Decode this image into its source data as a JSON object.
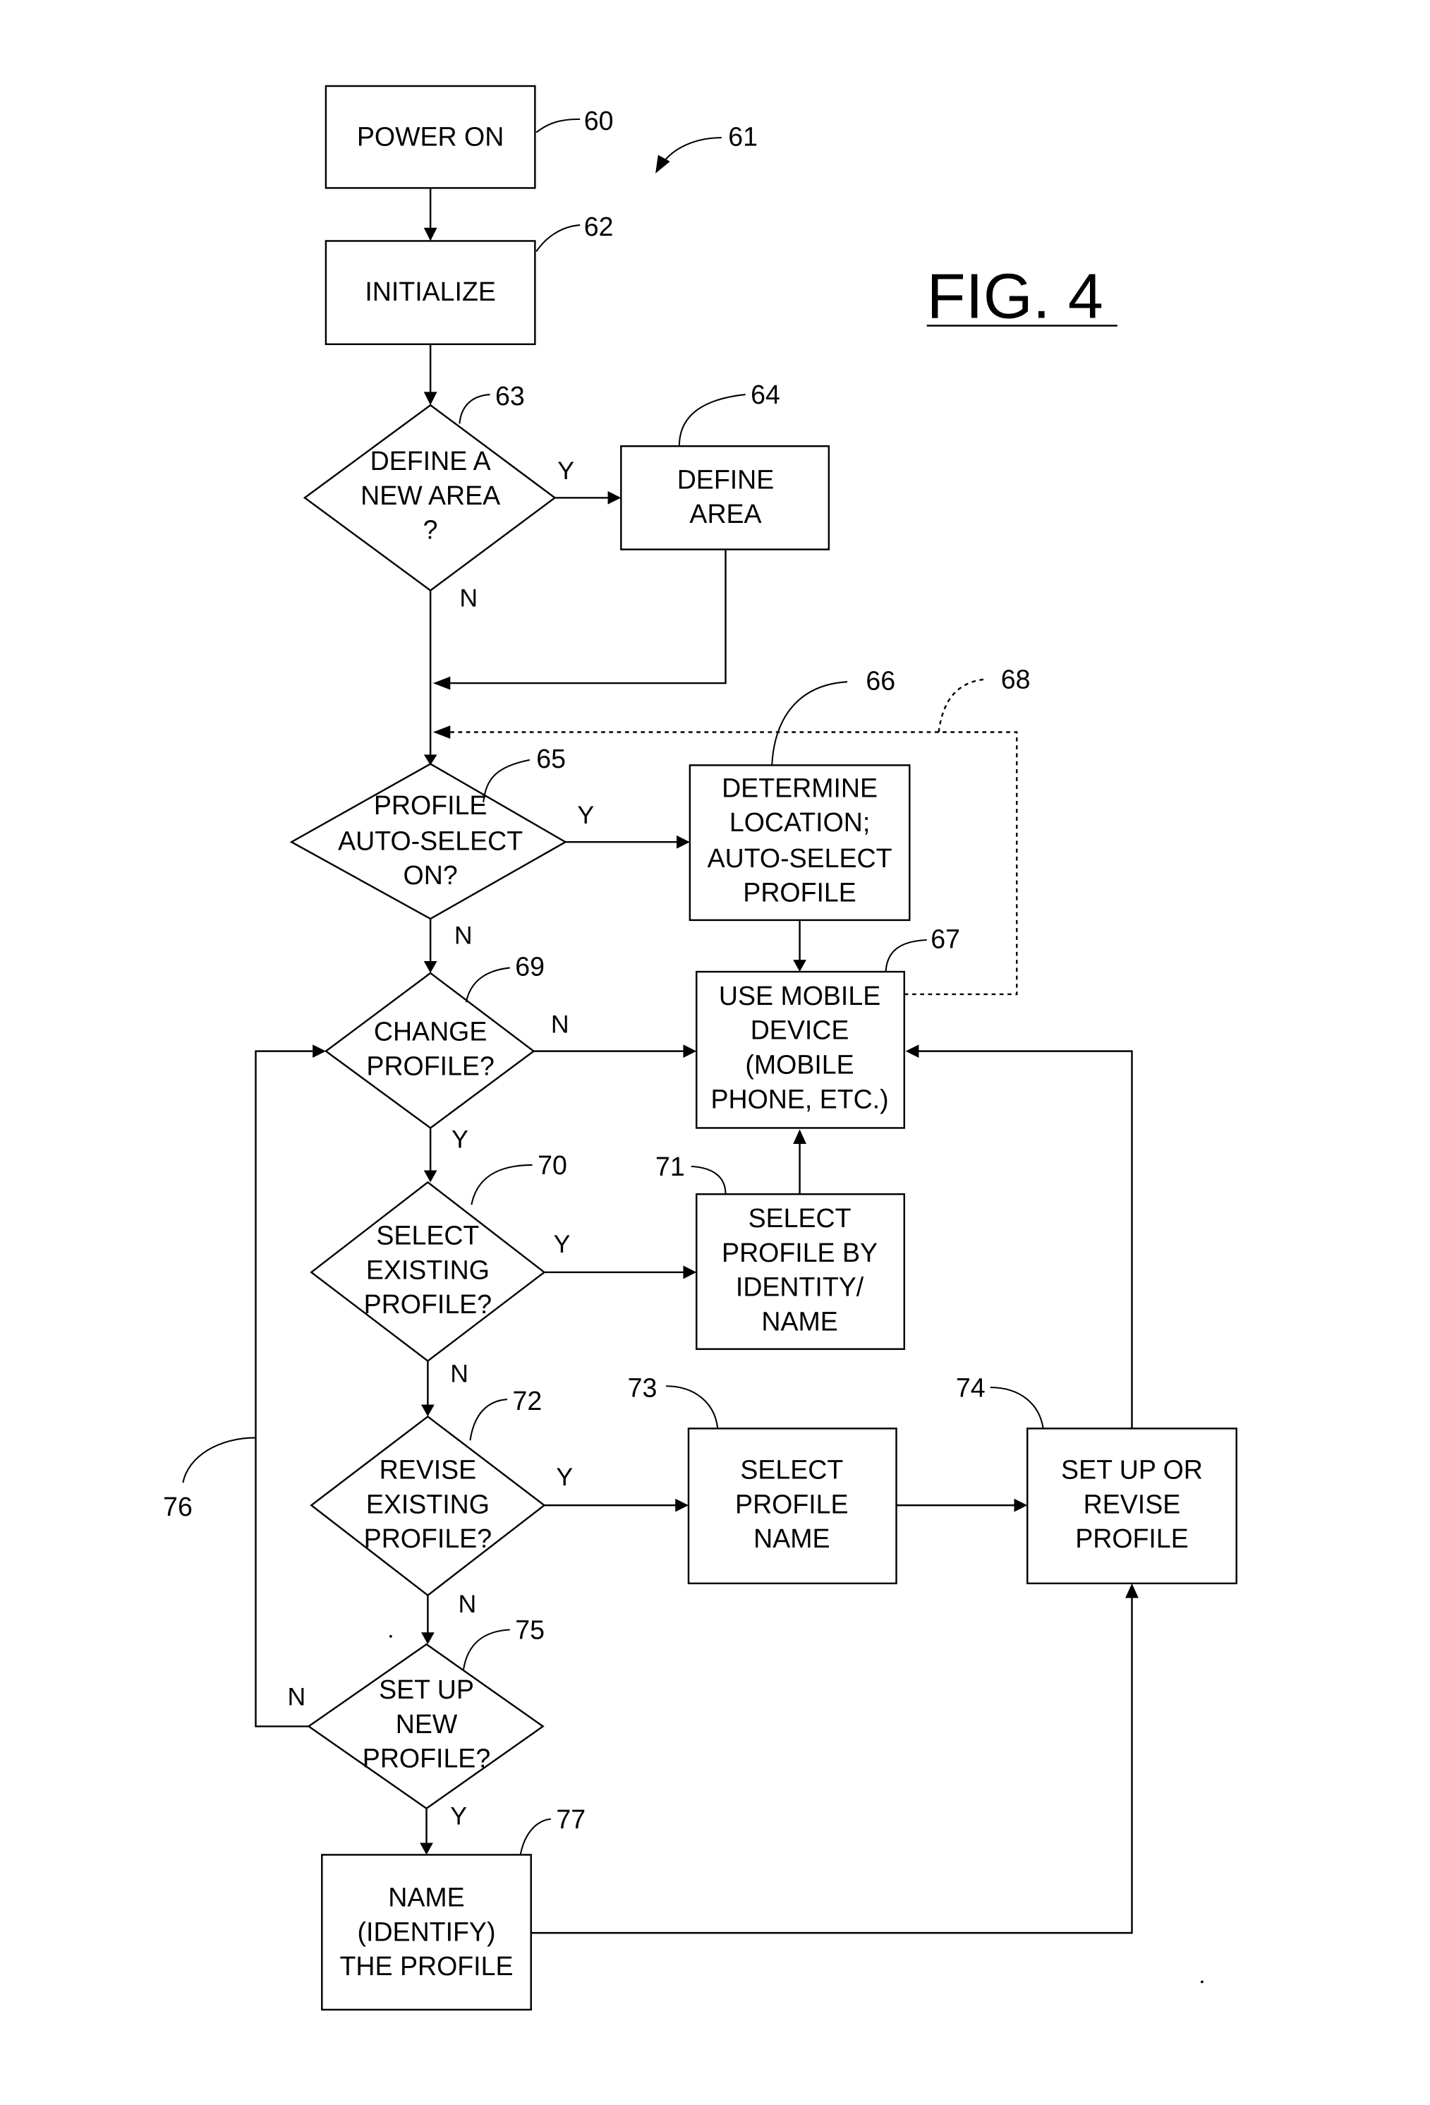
{
  "figure": {
    "title": "FIG. 4",
    "ref": "61"
  },
  "nodes": {
    "power_on": {
      "ref": "60",
      "lines": [
        "POWER ON"
      ]
    },
    "initialize": {
      "ref": "62",
      "lines": [
        "INITIALIZE"
      ]
    },
    "define_new_area": {
      "ref": "63",
      "lines": [
        "DEFINE A",
        "NEW AREA",
        "?"
      ]
    },
    "define_area": {
      "ref": "64",
      "lines": [
        "DEFINE",
        "AREA"
      ]
    },
    "auto_select_on": {
      "ref": "65",
      "lines": [
        "PROFILE",
        "AUTO-SELECT",
        "ON?"
      ]
    },
    "determine_location": {
      "ref": "66",
      "lines": [
        "DETERMINE",
        "LOCATION;",
        "AUTO-SELECT",
        "PROFILE"
      ]
    },
    "use_mobile_device": {
      "ref": "67",
      "lines": [
        "USE MOBILE",
        "DEVICE",
        "(MOBILE",
        "PHONE, ETC.)"
      ]
    },
    "change_profile": {
      "ref": "69",
      "lines": [
        "CHANGE",
        "PROFILE?"
      ]
    },
    "select_existing": {
      "ref": "70",
      "lines": [
        "SELECT",
        "EXISTING",
        "PROFILE?"
      ]
    },
    "select_by_identity": {
      "ref": "71",
      "lines": [
        "SELECT",
        "PROFILE  BY",
        "IDENTITY/",
        "NAME"
      ]
    },
    "revise_existing": {
      "ref": "72",
      "lines": [
        "REVISE",
        "EXISTING",
        "PROFILE?"
      ]
    },
    "select_profile_name": {
      "ref": "73",
      "lines": [
        "SELECT",
        "PROFILE",
        "NAME"
      ]
    },
    "setup_or_revise": {
      "ref": "74",
      "lines": [
        "SET UP OR",
        "REVISE",
        "PROFILE"
      ]
    },
    "setup_new": {
      "ref": "75",
      "lines": [
        "SET UP",
        "NEW",
        "PROFILE?"
      ]
    },
    "name_profile": {
      "ref": "77",
      "lines": [
        "NAME",
        "(IDENTIFY)",
        "THE PROFILE"
      ]
    }
  },
  "paths": {
    "dotted_loop_ref": "68",
    "loop_back_ref": "76"
  },
  "branch_labels": {
    "yes": "Y",
    "no": "N"
  }
}
